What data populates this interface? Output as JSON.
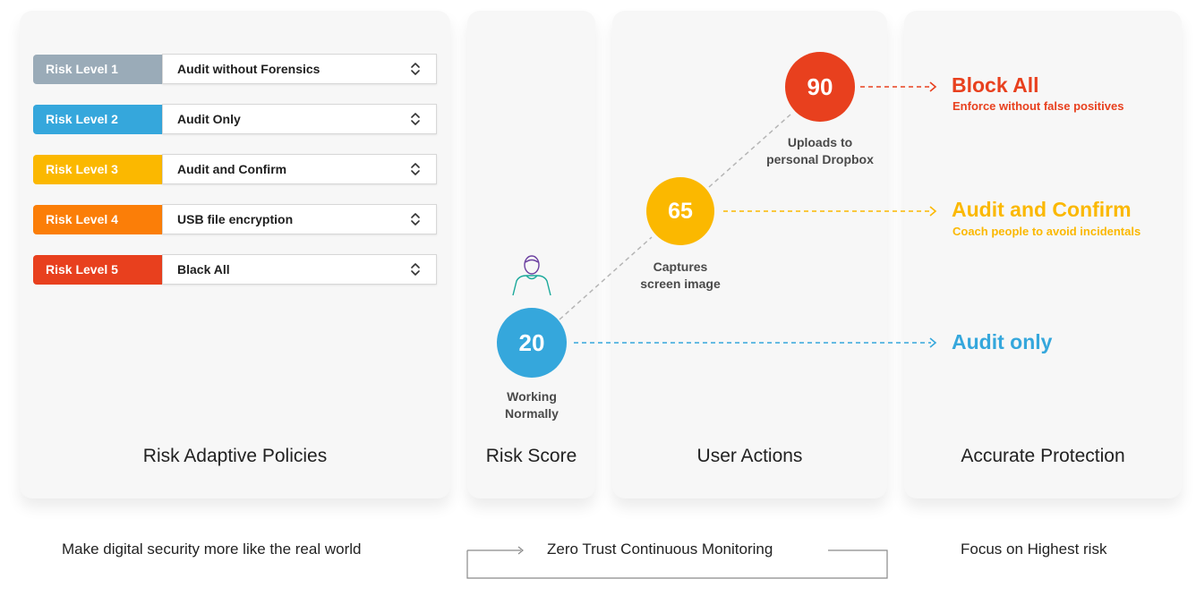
{
  "colors": {
    "level1": "#9aabb8",
    "level2": "#35a7dc",
    "level3": "#fbb800",
    "level4": "#fb7e08",
    "level5": "#e8401e",
    "panel": "#f7f7f7"
  },
  "policies": {
    "title": "Risk Adaptive Policies",
    "rows": [
      {
        "level": "Risk Level 1",
        "policy": "Audit without Forensics"
      },
      {
        "level": "Risk Level 2",
        "policy": "Audit Only"
      },
      {
        "level": "Risk Level 3",
        "policy": "Audit and Confirm"
      },
      {
        "level": "Risk Level 4",
        "policy": "USB file encryption"
      },
      {
        "level": "Risk Level 5",
        "policy": "Black All"
      }
    ]
  },
  "risk_score": {
    "title": "Risk Score",
    "value": "20",
    "label_line1": "Working",
    "label_line2": "Normally",
    "icon": "user-icon"
  },
  "user_actions": {
    "title": "User Actions",
    "nodes": [
      {
        "value": "65",
        "label_line1": "Captures",
        "label_line2": "screen image"
      },
      {
        "value": "90",
        "label_line1": "Uploads to",
        "label_line2": "personal Dropbox"
      }
    ]
  },
  "protection": {
    "title": "Accurate Protection",
    "outcomes": [
      {
        "title": "Block All",
        "subtitle": "Enforce without false positives"
      },
      {
        "title": "Audit and Confirm",
        "subtitle": "Coach people to avoid incidentals"
      },
      {
        "title": "Audit only",
        "subtitle": ""
      }
    ]
  },
  "footer": {
    "left": "Make digital  security more like the real world",
    "center": "Zero Trust Continuous Monitoring",
    "right": "Focus on Highest risk"
  }
}
